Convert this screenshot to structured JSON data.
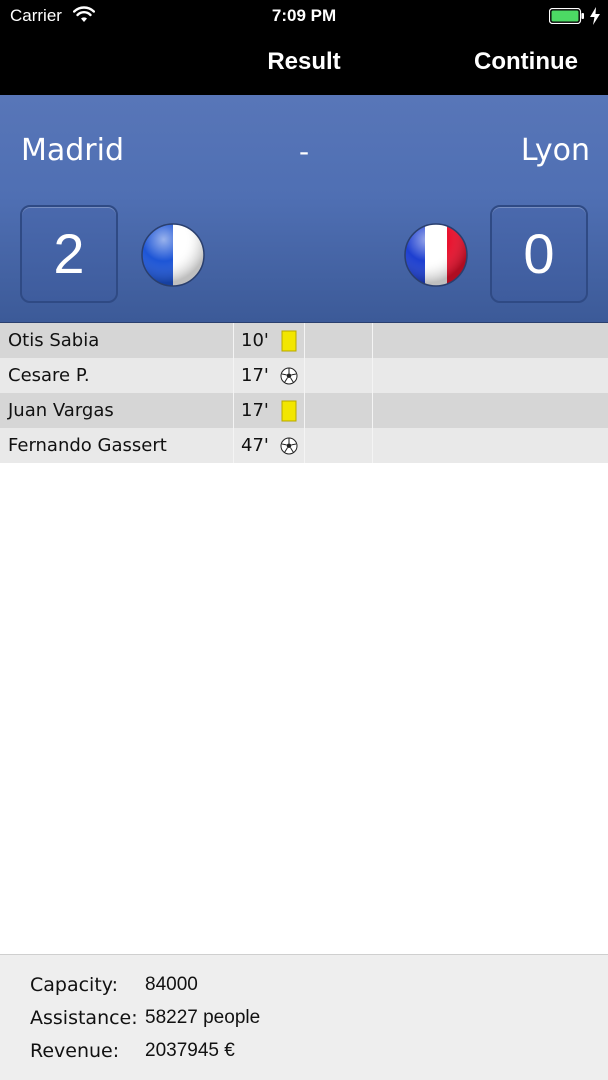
{
  "status_bar": {
    "carrier": "Carrier",
    "time": "7:09 PM"
  },
  "nav": {
    "title": "Result",
    "continue_label": "Continue"
  },
  "match": {
    "home_team": "Madrid",
    "separator": "-",
    "away_team": "Lyon",
    "home_score": "2",
    "away_score": "0"
  },
  "events": [
    {
      "player": "Otis Sabia",
      "minute": "10'",
      "icon": "yellow-card-icon"
    },
    {
      "player": "Cesare P.",
      "minute": "17'",
      "icon": "soccer-ball-icon"
    },
    {
      "player": "Juan Vargas",
      "minute": "17'",
      "icon": "yellow-card-icon"
    },
    {
      "player": "Fernando Gassert",
      "minute": "47'",
      "icon": "soccer-ball-icon"
    }
  ],
  "stadium": {
    "capacity_label": "Capacity:",
    "capacity_value": "84000",
    "assistance_label": "Assistance:",
    "assistance_value": "58227 people",
    "revenue_label": "Revenue:",
    "revenue_value": "2037945 €"
  },
  "colors": {
    "header_blue": "#4f6fb3",
    "yellow_card": "#f2e600",
    "battery_green": "#4cd964"
  }
}
